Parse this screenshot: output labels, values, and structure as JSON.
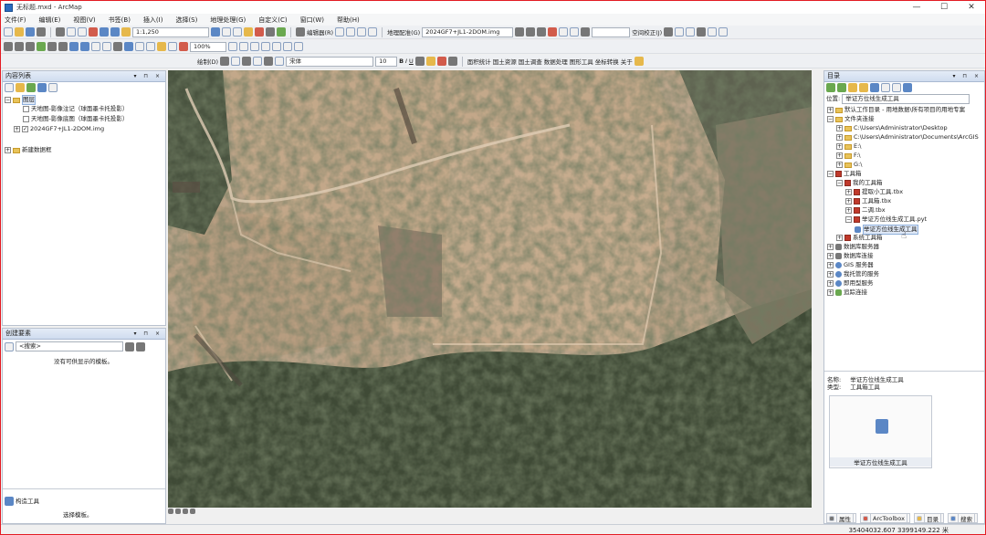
{
  "window": {
    "title": "无标题.mxd - ArcMap"
  },
  "menu": [
    "文件(F)",
    "编辑(E)",
    "视图(V)",
    "书签(B)",
    "插入(I)",
    "选择(S)",
    "地理处理(G)",
    "自定义(C)",
    "窗口(W)",
    "帮助(H)"
  ],
  "toolbar": {
    "scale": "1:1,250",
    "editor_label": "编辑器(R)",
    "georef_label": "地理配准(G)",
    "georef_layer": "2024GF7+JL1-2DOM.img",
    "space_label": "空间校正(J)",
    "zoom_pct": "100%",
    "drawing_label": "绘制(D)",
    "font_name": "宋体",
    "font_size": "10",
    "plugins": [
      "面积统计",
      "国土资源",
      "国土调查",
      "数据处理",
      "图形工具",
      "坐标转换",
      "关于"
    ]
  },
  "toc": {
    "title": "内容列表",
    "layers_label": "图层",
    "items": [
      "天地图-影像注记（球面墨卡托投影）",
      "天地图-影像底图（球面墨卡托投影）",
      "2024GF7+JL1-2DOM.img"
    ],
    "new_group": "新建数据框"
  },
  "create_features": {
    "title": "创建要素",
    "search_placeholder": "<搜索>",
    "empty_msg": "没有可供显示的模板。",
    "construct_label": "构造工具",
    "select_template": "选择模板。"
  },
  "catalog": {
    "title": "目录",
    "location_label": "位置:",
    "location_value": "举证方位线生成工具",
    "tree": [
      "默认工作目录 - 用地数据\\所有项目的用地专案",
      "文件夹连接",
      "C:\\Users\\Administrator\\Desktop",
      "C:\\Users\\Administrator\\Documents\\ArcGIS",
      "E:\\",
      "F:\\",
      "G:\\",
      "工具箱",
      "我的工具箱",
      "提取小工具.tbx",
      "工具箱.tbx",
      "二调.tbx",
      "举证方位线生成工具.pyt",
      "举证方位线生成工具",
      "系统工具箱",
      "数据库服务器",
      "数据库连接",
      "GIS 服务器",
      "我托管的服务",
      "即用型服务",
      "追踪连接"
    ],
    "info_name_label": "名称:",
    "info_name": "举证方位线生成工具",
    "info_type_label": "类型:",
    "info_type": "工具箱工具",
    "preview_label": "举证方位线生成工具",
    "tabs": [
      "属性",
      "ArcToolbox",
      "目录",
      "搜索"
    ]
  },
  "status": {
    "coords": "35404032.607  3399149.222 米"
  }
}
